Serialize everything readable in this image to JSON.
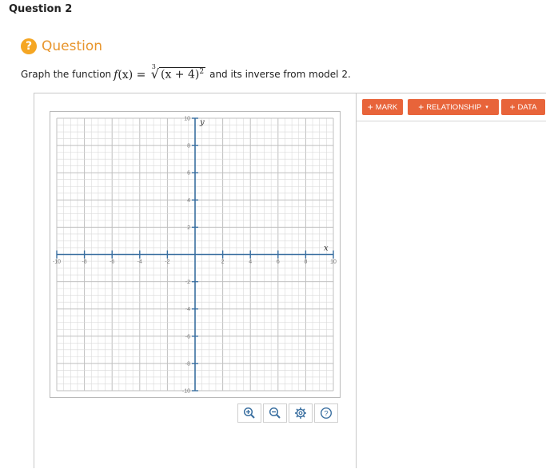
{
  "question": {
    "number_label": "Question 2",
    "help_badge": "?",
    "heading": "Question",
    "prompt_before": "Graph the function",
    "prompt_after": "and its inverse from model 2.",
    "formula": {
      "lhs_f": "f",
      "lhs_args": "(x) =",
      "radical_index": "3",
      "radicand": "(x + 4)",
      "exponent": "2"
    }
  },
  "toolbar": {
    "mark_label": "MARK",
    "relationship_label": "RELATIONSHIP",
    "data_label": "DATA",
    "plus": "+",
    "caret": "▾"
  },
  "graph": {
    "x_label": "x",
    "y_label": "y",
    "x_range": [
      -10,
      10
    ],
    "y_range": [
      -10,
      10
    ],
    "x_ticks": [
      -10,
      -8,
      -6,
      -4,
      -2,
      2,
      4,
      6,
      8,
      10
    ],
    "y_ticks": [
      10,
      8,
      6,
      4,
      2,
      -2,
      -4,
      -6,
      -8,
      -10
    ],
    "grid": true,
    "colors": {
      "axis": "#3a6fa0",
      "grid": "#d9d9d9",
      "major_grid": "#bfbfbf"
    }
  },
  "tools": [
    {
      "icon": "zoom-in-icon",
      "name": "zoom-in-button"
    },
    {
      "icon": "zoom-out-icon",
      "name": "zoom-out-button"
    },
    {
      "icon": "gear-icon",
      "name": "settings-button"
    },
    {
      "icon": "help-icon",
      "name": "help-button"
    }
  ],
  "colors": {
    "accent": "#e8643a",
    "heading": "#e8952c",
    "badge": "#f5a623"
  }
}
